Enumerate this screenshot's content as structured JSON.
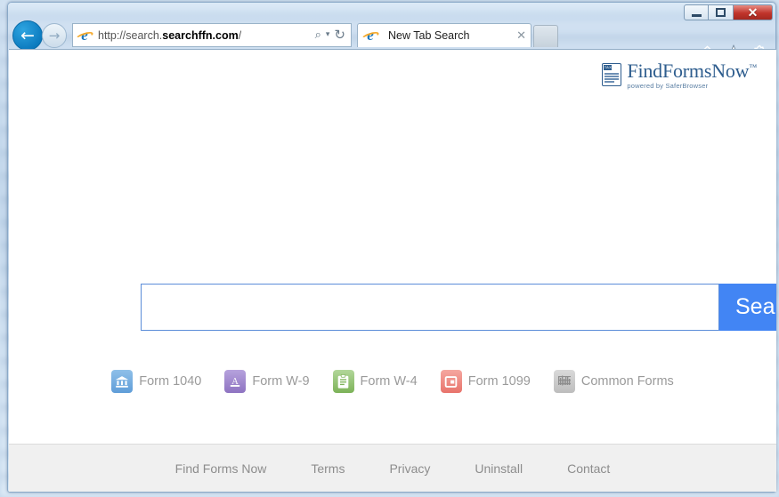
{
  "window": {
    "minimize_label": "Minimize",
    "maximize_label": "Restore",
    "close_label": "✕"
  },
  "browser": {
    "back_label": "←",
    "forward_label": "→",
    "address_url_prefix": "http://search.",
    "address_url_domain": "searchffn.com",
    "address_url_suffix": "/",
    "address_placeholder": "http://search.searchffn.com/",
    "search_glyph": "⌕",
    "dropdown_glyph": "▾",
    "refresh_glyph": "↻",
    "tab_title": "New Tab Search",
    "tab_close": "✕",
    "new_tab_label": "",
    "home_icon": "home-icon",
    "favorites_icon": "star-icon",
    "settings_icon": "gear-icon"
  },
  "page": {
    "logo": {
      "badge_text": "TAX",
      "name": "FindFormsNow",
      "trademark": "™",
      "tagline": "powered by SaferBrowser"
    },
    "search": {
      "value": "",
      "placeholder": "",
      "button_label": "Search"
    },
    "quick_links": [
      {
        "label": "Form 1040",
        "icon": "bank-icon",
        "color": "#6ba3dd",
        "glyph": "🏛"
      },
      {
        "label": "Form W-9",
        "icon": "letter-a-icon",
        "color": "#9b83c9",
        "glyph": "A"
      },
      {
        "label": "Form W-4",
        "icon": "clipboard-icon",
        "color": "#8cbf6e",
        "glyph": "▤"
      },
      {
        "label": "Form 1099",
        "icon": "card-icon",
        "color": "#ef8780",
        "glyph": "▣"
      },
      {
        "label": "Common Forms",
        "icon": "scribble-icon",
        "color": "#b3b3b3",
        "glyph": "▨"
      }
    ],
    "footer_links": [
      {
        "label": "Find Forms Now"
      },
      {
        "label": "Terms"
      },
      {
        "label": "Privacy"
      },
      {
        "label": "Uninstall"
      },
      {
        "label": "Contact"
      }
    ]
  },
  "colors": {
    "accent_blue": "#4285f4",
    "logo_blue": "#2e5d8e",
    "footer_bg": "#f0f0f0",
    "close_red": "#c0342b"
  }
}
